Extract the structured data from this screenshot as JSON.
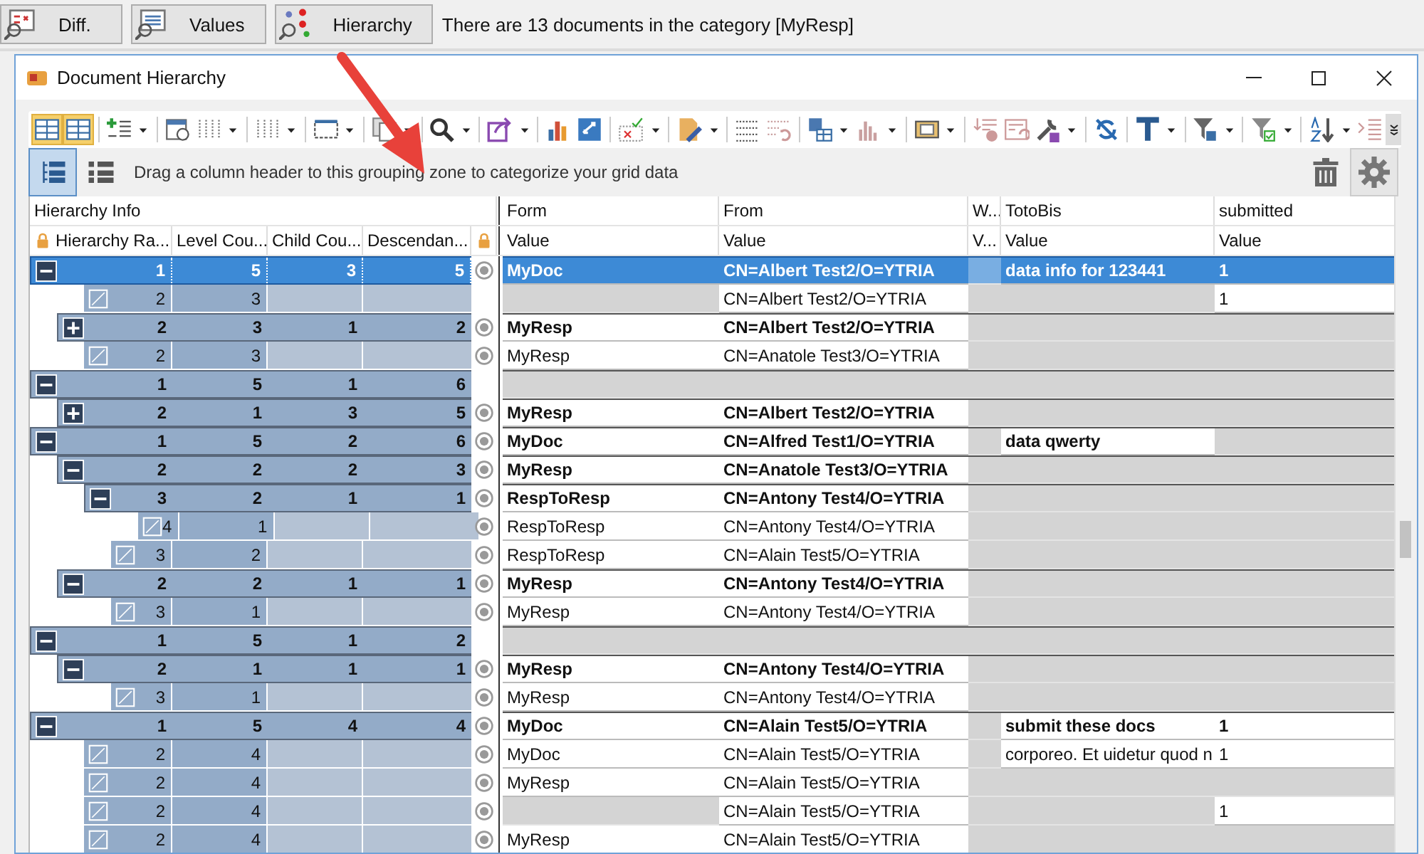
{
  "app_toolbar": {
    "buttons": [
      {
        "kind": "diff",
        "label": "Diff."
      },
      {
        "kind": "values",
        "label": "Values"
      },
      {
        "kind": "hierarchy",
        "label": "Hierarchy"
      }
    ],
    "message": "There are 13 documents in the category [MyResp]"
  },
  "window": {
    "title": "Document Hierarchy"
  },
  "toolbar": {
    "layout_toggles": [
      {
        "on": true
      },
      {
        "on": true
      }
    ]
  },
  "group_panel": {
    "view_buttons": [
      {
        "kind": "tree",
        "selected": true
      },
      {
        "kind": "list",
        "selected": false
      }
    ],
    "hint": "Drag a column header to this grouping zone to categorize your grid data"
  },
  "grid": {
    "header_groups": [
      "Hierarchy Info",
      "Form",
      "From",
      "W...",
      "TotoBis",
      "submitted"
    ],
    "columns": [
      "Hierarchy Ra...",
      "Level Cou...",
      "Child Cou...",
      "Descendan...",
      "Value",
      "Value",
      "V...",
      "Value",
      "Value"
    ],
    "rows": [
      {
        "kind": "group",
        "expanded": true,
        "selected": true,
        "radio": true,
        "rank": "1",
        "level_count": "5",
        "child_count": "3",
        "descendants": "5",
        "values": {
          "form": "MyDoc",
          "from": "CN=Albert Test2/O=YTRIA",
          "totobis": "data info for 123441",
          "submitted": "1"
        },
        "children": [
          {
            "kind": "document",
            "selected": false,
            "radio": false,
            "rank": "2",
            "level_count": "3",
            "values": {
              "from": "CN=Albert Test2/O=YTRIA",
              "submitted": "1"
            }
          },
          {
            "kind": "group",
            "expanded": false,
            "selected": false,
            "radio": true,
            "rank": "2",
            "level_count": "3",
            "child_count": "1",
            "descendants": "2",
            "values": {
              "form": "MyResp",
              "from": "CN=Albert Test2/O=YTRIA"
            }
          },
          {
            "kind": "document",
            "selected": false,
            "radio": true,
            "rank": "2",
            "level_count": "3",
            "values": {
              "form": "MyResp",
              "from": "CN=Anatole Test3/O=YTRIA"
            }
          }
        ]
      },
      {
        "kind": "group",
        "expanded": true,
        "selected": false,
        "radio": false,
        "rank": "1",
        "level_count": "5",
        "child_count": "1",
        "descendants": "6",
        "values": {},
        "children": [
          {
            "kind": "group",
            "expanded": false,
            "selected": false,
            "radio": true,
            "rank": "2",
            "level_count": "1",
            "child_count": "3",
            "descendants": "5",
            "values": {
              "form": "MyResp",
              "from": "CN=Albert Test2/O=YTRIA"
            }
          }
        ]
      },
      {
        "kind": "group",
        "expanded": true,
        "selected": false,
        "radio": true,
        "rank": "1",
        "level_count": "5",
        "child_count": "2",
        "descendants": "6",
        "values": {
          "form": "MyDoc",
          "from": "CN=Alfred Test1/O=YTRIA",
          "totobis": "data qwerty"
        },
        "children": [
          {
            "kind": "group",
            "expanded": true,
            "selected": false,
            "radio": true,
            "rank": "2",
            "level_count": "2",
            "child_count": "2",
            "descendants": "3",
            "values": {
              "form": "MyResp",
              "from": "CN=Anatole Test3/O=YTRIA"
            },
            "children": [
              {
                "kind": "group",
                "expanded": true,
                "selected": false,
                "radio": true,
                "rank": "3",
                "level_count": "2",
                "child_count": "1",
                "descendants": "1",
                "values": {
                  "form": "RespToResp",
                  "from": "CN=Antony Test4/O=YTRIA"
                },
                "children": [
                  {
                    "kind": "document",
                    "selected": false,
                    "radio": true,
                    "rank": "4",
                    "level_count": "1",
                    "values": {
                      "form": "RespToResp",
                      "from": "CN=Antony Test4/O=YTRIA"
                    }
                  }
                ]
              },
              {
                "kind": "document",
                "selected": false,
                "radio": true,
                "rank": "3",
                "level_count": "2",
                "values": {
                  "form": "RespToResp",
                  "from": "CN=Alain Test5/O=YTRIA"
                }
              }
            ]
          },
          {
            "kind": "group",
            "expanded": true,
            "selected": false,
            "radio": true,
            "rank": "2",
            "level_count": "2",
            "child_count": "1",
            "descendants": "1",
            "values": {
              "form": "MyResp",
              "from": "CN=Antony Test4/O=YTRIA"
            },
            "children": [
              {
                "kind": "document",
                "selected": false,
                "radio": true,
                "rank": "3",
                "level_count": "1",
                "values": {
                  "form": "MyResp",
                  "from": "CN=Antony Test4/O=YTRIA"
                }
              }
            ]
          }
        ]
      },
      {
        "kind": "group",
        "expanded": true,
        "selected": false,
        "radio": false,
        "rank": "1",
        "level_count": "5",
        "child_count": "1",
        "descendants": "2",
        "values": {},
        "children": [
          {
            "kind": "group",
            "expanded": true,
            "selected": false,
            "radio": true,
            "rank": "2",
            "level_count": "1",
            "child_count": "1",
            "descendants": "1",
            "values": {
              "form": "MyResp",
              "from": "CN=Antony Test4/O=YTRIA"
            },
            "children": [
              {
                "kind": "document",
                "selected": false,
                "radio": true,
                "rank": "3",
                "level_count": "1",
                "values": {
                  "form": "MyResp",
                  "from": "CN=Antony Test4/O=YTRIA"
                }
              }
            ]
          }
        ]
      },
      {
        "kind": "group",
        "expanded": true,
        "selected": false,
        "radio": true,
        "rank": "1",
        "level_count": "5",
        "child_count": "4",
        "descendants": "4",
        "values": {
          "form": "MyDoc",
          "from": "CN=Alain Test5/O=YTRIA",
          "totobis": "submit these docs",
          "submitted": "1"
        },
        "children": [
          {
            "kind": "document",
            "selected": false,
            "radio": true,
            "rank": "2",
            "level_count": "4",
            "values": {
              "form": "MyDoc",
              "from": "CN=Alain Test5/O=YTRIA",
              "totobis": "corporeo. Et uidetur quod n",
              "submitted": "1"
            }
          },
          {
            "kind": "document",
            "selected": false,
            "radio": true,
            "rank": "2",
            "level_count": "4",
            "values": {
              "form": "MyResp",
              "from": "CN=Alain Test5/O=YTRIA"
            }
          },
          {
            "kind": "document",
            "selected": false,
            "radio": true,
            "rank": "2",
            "level_count": "4",
            "values": {
              "from": "CN=Alain Test5/O=YTRIA",
              "submitted": "1"
            }
          },
          {
            "kind": "document",
            "selected": false,
            "radio": true,
            "rank": "2",
            "level_count": "4",
            "values": {
              "form": "MyResp",
              "from": "CN=Alain Test5/O=YTRIA"
            }
          }
        ]
      }
    ]
  }
}
